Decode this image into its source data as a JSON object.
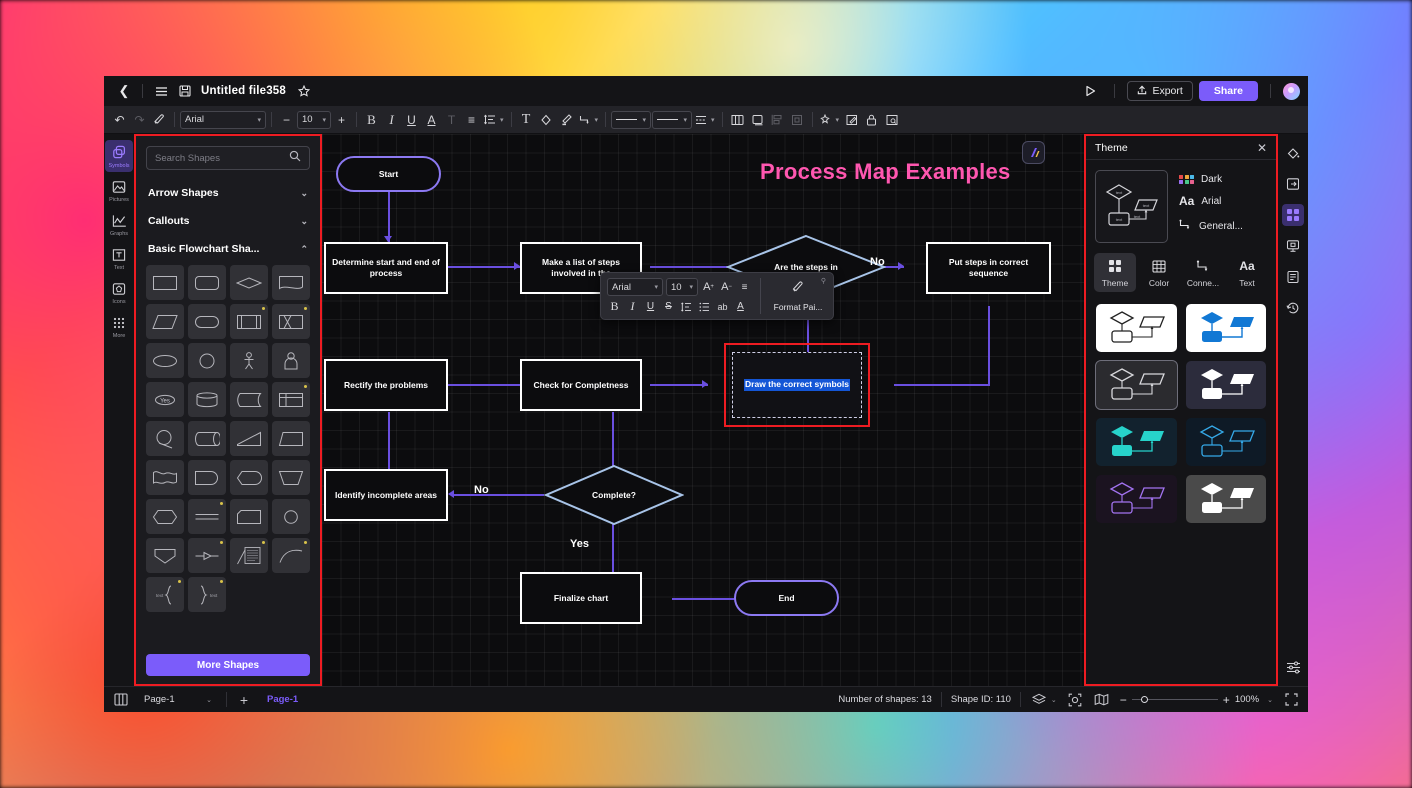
{
  "titlebar": {
    "back_icon": "chevron-left-icon",
    "menu_icon": "hamburger-menu-icon",
    "save_icon": "save-disk-icon",
    "doc_title": "Untitled file358",
    "favorite_icon": "star-icon",
    "present_icon": "play-triangle-icon",
    "export_label": "Export",
    "export_icon": "upload-icon",
    "share_label": "Share",
    "avatar": "user-avatar"
  },
  "toolbar": {
    "undo": "↶",
    "redo": "↷",
    "format_painter": "⊿",
    "font_family": "Arial",
    "font_size": "10",
    "minus": "−",
    "plus": "+",
    "bold": "B",
    "italic": "I",
    "underline": "U",
    "font_color": "A",
    "clear_format": "T",
    "align": "≡",
    "line_spacing": "≜",
    "text_box": "T",
    "fill": "◇",
    "pen": "✎",
    "connector": "⌐",
    "line_style_1": "———",
    "line_style_2": "———",
    "list": "≣",
    "copy_style": "⧉",
    "duplicate": "❏",
    "align_objects": "⊞",
    "distribute": "⊟",
    "effects": "✧",
    "edit": "✐",
    "lock": "🔒",
    "crop": "⊡"
  },
  "left_rail": {
    "items": [
      {
        "label": "Symbols",
        "icon": "symbols-icon",
        "active": true
      },
      {
        "label": "Pictures",
        "icon": "picture-icon",
        "active": false
      },
      {
        "label": "Graphs",
        "icon": "chart-line-icon",
        "active": false
      },
      {
        "label": "Text",
        "icon": "text-box-icon",
        "active": false
      },
      {
        "label": "Icons",
        "icon": "icons-icon",
        "active": false
      },
      {
        "label": "More",
        "icon": "grid-dots-icon",
        "active": false
      }
    ]
  },
  "shapes_panel": {
    "search_placeholder": "Search Shapes",
    "search_value": "",
    "search_icon": "search-icon",
    "sections": [
      {
        "label": "Arrow Shapes",
        "expanded": false
      },
      {
        "label": "Callouts",
        "expanded": false
      },
      {
        "label": "Basic Flowchart Sha...",
        "expanded": true
      }
    ],
    "more_shapes_label": "More Shapes",
    "shape_cells": [
      {
        "name": "process-rect",
        "badge": false
      },
      {
        "name": "rounded-rect",
        "badge": false
      },
      {
        "name": "decision-diamond",
        "badge": false
      },
      {
        "name": "document",
        "badge": false
      },
      {
        "name": "data-parallelogram",
        "badge": false
      },
      {
        "name": "terminator",
        "badge": false
      },
      {
        "name": "predefined-process",
        "badge": true
      },
      {
        "name": "internal-storage",
        "badge": true
      },
      {
        "name": "ellipse",
        "badge": false
      },
      {
        "name": "circle",
        "badge": false
      },
      {
        "name": "actor-person",
        "badge": false
      },
      {
        "name": "user-bust",
        "badge": false
      },
      {
        "name": "yes-oval",
        "badge": false
      },
      {
        "name": "database-cylinder",
        "badge": false
      },
      {
        "name": "stored-data",
        "badge": false
      },
      {
        "name": "table-shape",
        "badge": true
      },
      {
        "name": "circle-connector",
        "badge": false
      },
      {
        "name": "direct-access-storage",
        "badge": false
      },
      {
        "name": "trapezoid-offpage",
        "badge": false
      },
      {
        "name": "manual-operation",
        "badge": false
      },
      {
        "name": "multi-document",
        "badge": false
      },
      {
        "name": "delay-shape",
        "badge": false
      },
      {
        "name": "display-shape",
        "badge": false
      },
      {
        "name": "manual-input",
        "badge": false
      },
      {
        "name": "hexagon-preparation",
        "badge": false
      },
      {
        "name": "divided-bar",
        "badge": true
      },
      {
        "name": "card-shape",
        "badge": false
      },
      {
        "name": "connector-circle",
        "badge": false
      },
      {
        "name": "extract-pentagon",
        "badge": false
      },
      {
        "name": "merge-arrow",
        "badge": true
      },
      {
        "name": "note-text-shape",
        "badge": true
      },
      {
        "name": "curve-shape",
        "badge": true
      },
      {
        "name": "left-brace",
        "badge": true
      },
      {
        "name": "right-brace",
        "badge": true
      }
    ]
  },
  "canvas": {
    "title": "Process Map Examples",
    "watermark_icon": "app-logo-badge",
    "nodes": [
      {
        "id": "start",
        "text": "Start",
        "shape": "terminator"
      },
      {
        "id": "n1",
        "text": "Determine start and end of process",
        "shape": "rect"
      },
      {
        "id": "n2",
        "text": "Make a list of steps involved in the",
        "shape": "rect"
      },
      {
        "id": "d1",
        "text": "Are the steps in",
        "shape": "diamond"
      },
      {
        "id": "n3",
        "text": "Put steps in correct sequence",
        "shape": "rect"
      },
      {
        "id": "n4",
        "text": "Rectify the problems",
        "shape": "rect"
      },
      {
        "id": "n5",
        "text": "Check for Completness",
        "shape": "rect"
      },
      {
        "id": "n6",
        "text": "Draw the correct symbols",
        "shape": "rect-selected"
      },
      {
        "id": "n7",
        "text": "Identify incomplete areas",
        "shape": "rect"
      },
      {
        "id": "d2",
        "text": "Complete?",
        "shape": "diamond"
      },
      {
        "id": "n8",
        "text": "Finalize chart",
        "shape": "rect"
      },
      {
        "id": "end",
        "text": "End",
        "shape": "terminator"
      }
    ],
    "edge_labels": [
      {
        "text": "No",
        "at": "d1-right"
      },
      {
        "text": "Yes",
        "at": "d1-bottom"
      },
      {
        "text": "No",
        "at": "d2-left"
      },
      {
        "text": "Yes",
        "at": "d2-bottom"
      }
    ]
  },
  "mini_toolbar": {
    "font_family": "Arial",
    "font_size": "10",
    "grow_font": "A",
    "shrink_font": "A",
    "align": "≡",
    "bold": "B",
    "italic": "I",
    "underline": "U",
    "strike": "S",
    "line_spacing": "≔",
    "bullets": "≔",
    "case": "ab",
    "font_color": "A",
    "painter_icon": "format-painter-icon",
    "format_painter_label": "Format Pai...",
    "pin_icon": "pin-icon"
  },
  "theme_panel": {
    "title": "Theme",
    "close_icon": "close-icon",
    "preview": "flowchart-thumbnail",
    "meta": [
      {
        "icon": "color-swatches-icon",
        "label": "Dark"
      },
      {
        "icon": "font-aa-icon",
        "label": "Arial"
      },
      {
        "icon": "connector-icon",
        "label": "General..."
      }
    ],
    "tabs": [
      {
        "label": "Theme",
        "icon": "theme-grid-icon",
        "active": true
      },
      {
        "label": "Color",
        "icon": "color-table-icon",
        "active": false
      },
      {
        "label": "Conne...",
        "icon": "connector-icon",
        "active": false
      },
      {
        "label": "Text",
        "icon": "text-aa-icon",
        "active": false
      }
    ],
    "themes": [
      {
        "name": "light-white",
        "bg": "#ffffff",
        "stroke": "#222222",
        "fill": "#ffffff",
        "selected": false
      },
      {
        "name": "blue",
        "bg": "#ffffff",
        "stroke": "#1178d4",
        "fill": "#1178d4",
        "selected": false
      },
      {
        "name": "dark-gray",
        "bg": "#2b2b2f",
        "stroke": "#d8d8dc",
        "fill": "#2b2b2f",
        "selected": true
      },
      {
        "name": "navy-white",
        "bg": "#2c2c3c",
        "stroke": "#ffffff",
        "fill": "#ffffff",
        "selected": false
      },
      {
        "name": "teal-fill",
        "bg": "#12222e",
        "stroke": "#27d3cb",
        "fill": "#27d3cb",
        "selected": false
      },
      {
        "name": "cyan-outline",
        "bg": "#0e1a26",
        "stroke": "#35a9e8",
        "fill": "#0e1a26",
        "selected": false
      },
      {
        "name": "purple",
        "bg": "#1b1320",
        "stroke": "#a273f0",
        "fill": "#1b1320",
        "selected": false
      },
      {
        "name": "gray-white",
        "bg": "#4a4a4a",
        "stroke": "#ffffff",
        "fill": "#ffffff",
        "selected": false
      }
    ]
  },
  "right_rail": {
    "items": [
      {
        "icon": "fill-bucket-icon",
        "active": false
      },
      {
        "icon": "page-setup-icon",
        "active": false
      },
      {
        "icon": "theme-grid-icon",
        "active": true
      },
      {
        "icon": "presentation-icon",
        "active": false
      },
      {
        "icon": "document-icon",
        "active": false
      },
      {
        "icon": "history-icon",
        "active": false
      }
    ],
    "bottom_icon": "settings-sliders-icon"
  },
  "statusbar": {
    "panel_toggle_icon": "panel-toggle-icon",
    "page_name": "Page-1",
    "add_page_icon": "+",
    "page_tab": "Page-1",
    "shape_count": "Number of shapes: 13",
    "shape_id": "Shape ID: 110",
    "layers_icon": "layers-icon",
    "focus_icon": "focus-icon",
    "map_icon": "map-icon",
    "zoom_minus": "−",
    "zoom_plus": "+",
    "zoom_level": "100%",
    "fullscreen_icon": "fullscreen-icon"
  },
  "colors": {
    "accent": "#7b5cfa",
    "selection_red": "#ee1c22",
    "title_pink": "#ff57b0",
    "edge": "#6a4fe0",
    "diamond_stroke": "#a8c4e8"
  }
}
